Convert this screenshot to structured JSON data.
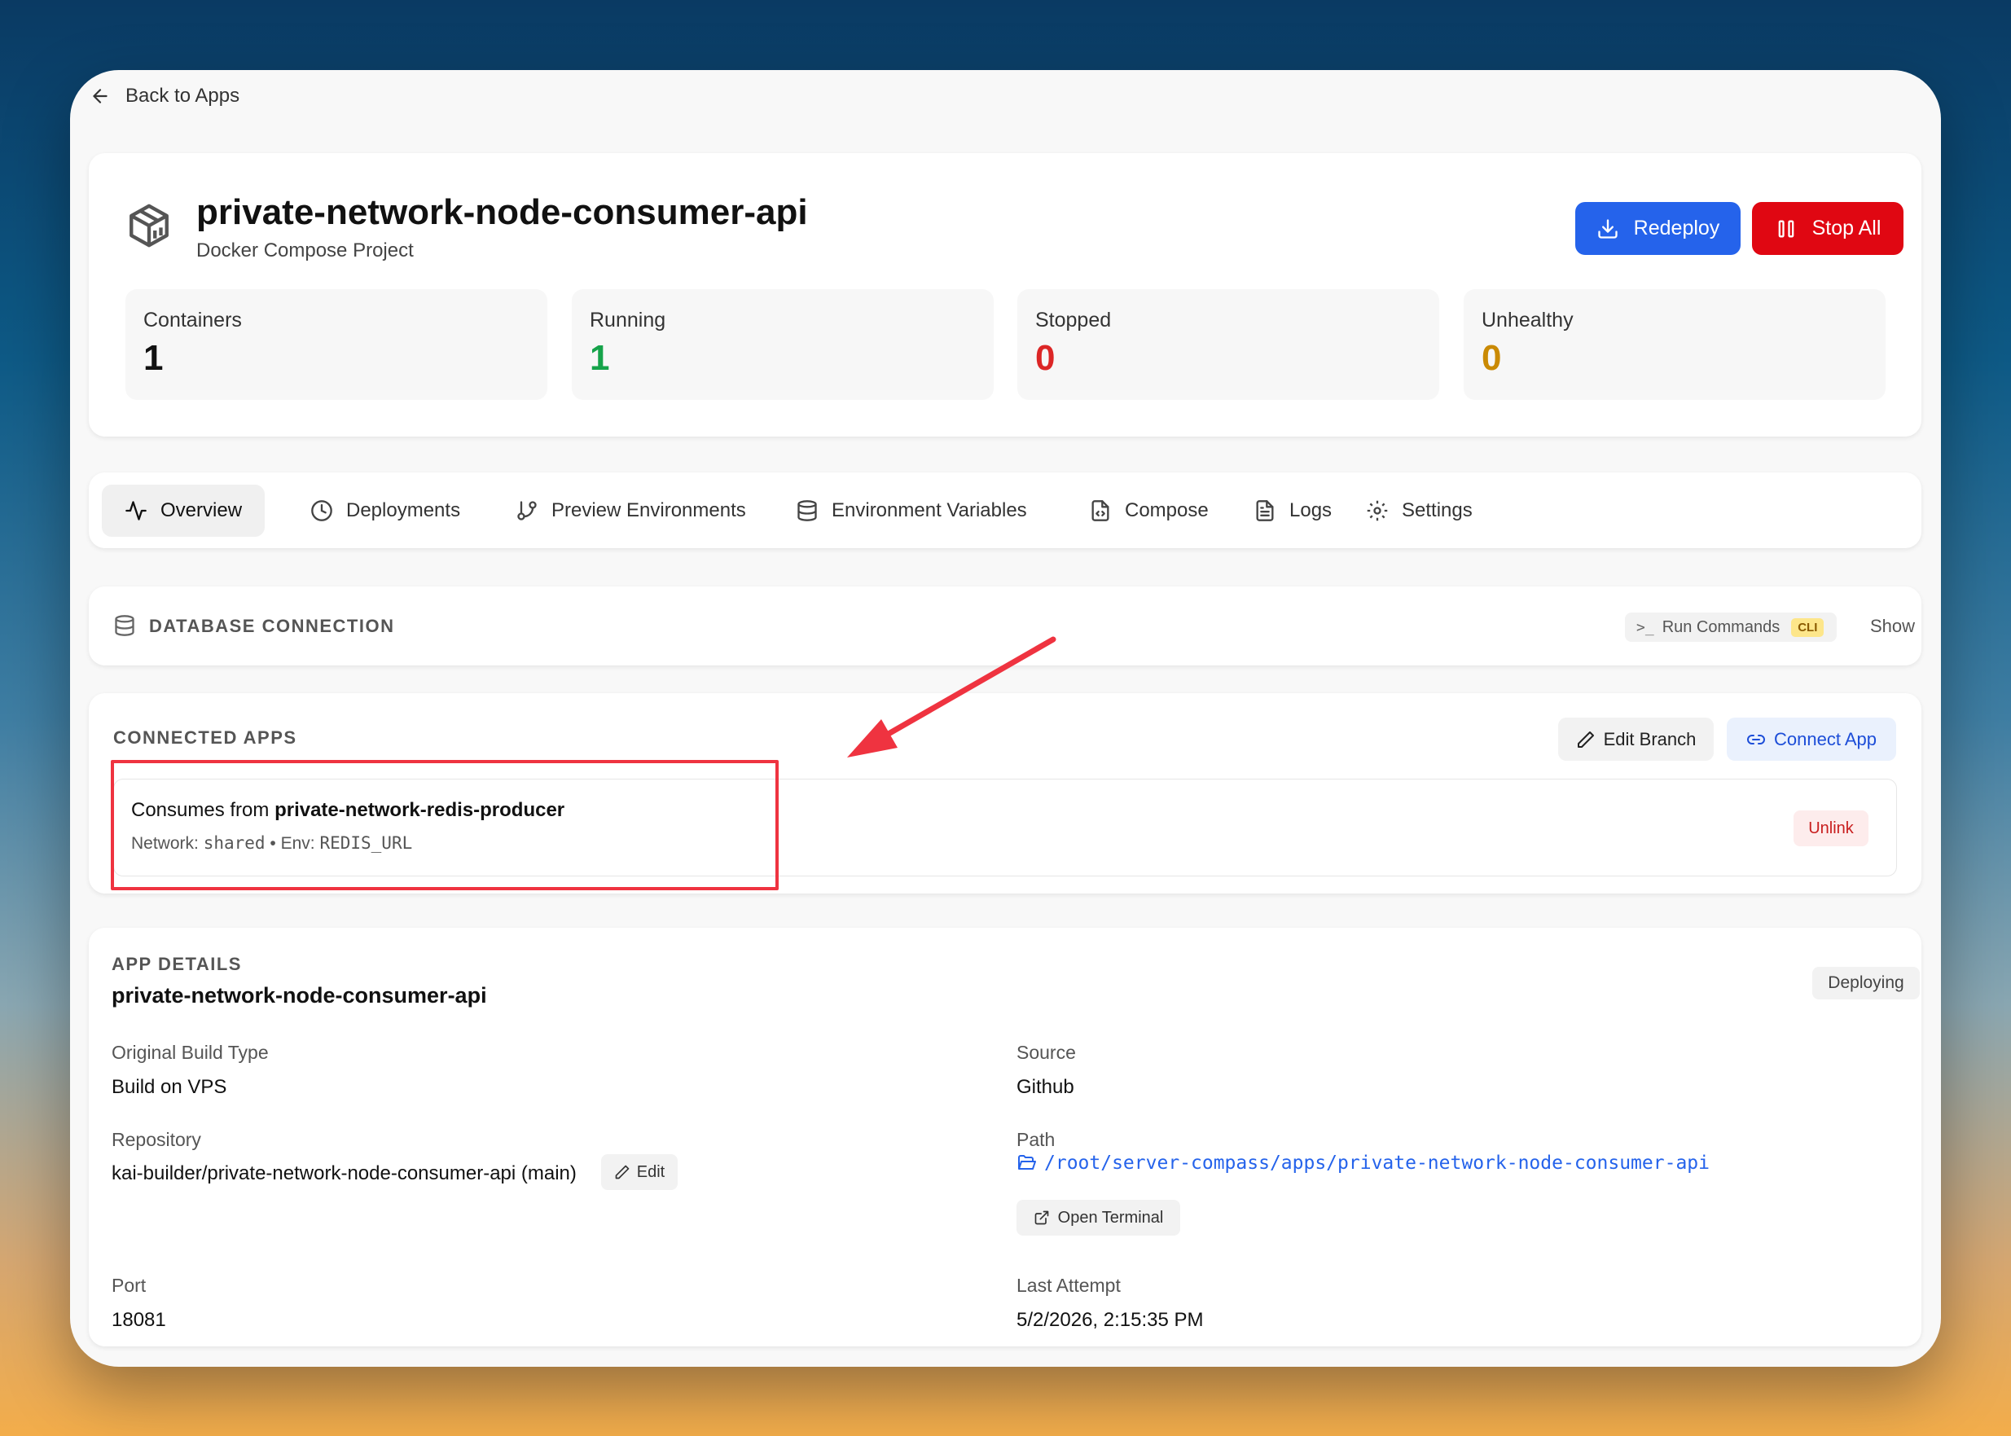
{
  "back_label": "Back to Apps",
  "header": {
    "title": "private-network-node-consumer-api",
    "subtitle": "Docker Compose Project",
    "redeploy_label": "Redeploy",
    "stop_label": "Stop All"
  },
  "stats": [
    {
      "label": "Containers",
      "value": "1",
      "color": "#111111"
    },
    {
      "label": "Running",
      "value": "1",
      "color": "#16a34a"
    },
    {
      "label": "Stopped",
      "value": "0",
      "color": "#dc2626"
    },
    {
      "label": "Unhealthy",
      "value": "0",
      "color": "#ca8a04"
    }
  ],
  "tabs": [
    {
      "label": "Overview",
      "icon": "activity-icon",
      "active": true
    },
    {
      "label": "Deployments",
      "icon": "clock-icon"
    },
    {
      "label": "Preview Environments",
      "icon": "git-branch-icon"
    },
    {
      "label": "Environment Variables",
      "icon": "database-icon"
    },
    {
      "label": "Compose",
      "icon": "file-code-icon"
    },
    {
      "label": "Logs",
      "icon": "file-text-icon"
    },
    {
      "label": "Settings",
      "icon": "gear-icon"
    }
  ],
  "db_connection": {
    "title": "DATABASE CONNECTION",
    "run_commands": "Run Commands",
    "cli_badge": "CLI",
    "show": "Show"
  },
  "connected_apps": {
    "title": "CONNECTED APPS",
    "edit_branch": "Edit Branch",
    "connect_app": "Connect App",
    "item": {
      "prefix": "Consumes from ",
      "app": "private-network-redis-producer",
      "network_label": "Network: ",
      "network": "shared",
      "env_label": " • Env: ",
      "env": "REDIS_URL",
      "unlink": "Unlink"
    }
  },
  "app_details": {
    "title": "APP DETAILS",
    "name": "private-network-node-consumer-api",
    "status": "Deploying",
    "build_type_label": "Original Build Type",
    "build_type": "Build on VPS",
    "source_label": "Source",
    "source": "Github",
    "repo_label": "Repository",
    "repo": "kai-builder/private-network-node-consumer-api (main)",
    "edit": "Edit",
    "path_label": "Path",
    "path": "/root/server-compass/apps/private-network-node-consumer-api",
    "open_terminal": "Open Terminal",
    "port_label": "Port",
    "port": "18081",
    "last_attempt_label": "Last Attempt",
    "last_attempt": "5/2/2026, 2:15:35 PM"
  }
}
